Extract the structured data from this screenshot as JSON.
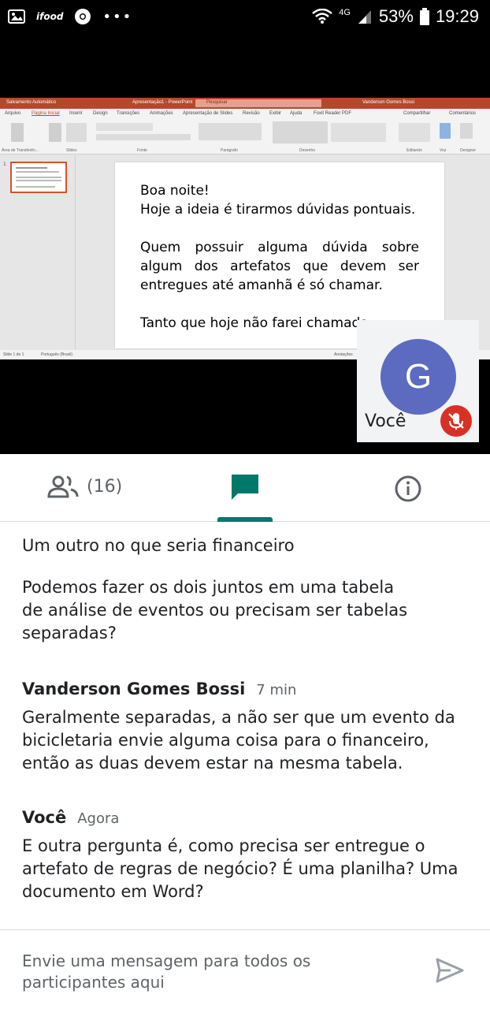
{
  "status_bar": {
    "network": "4G",
    "battery": "53%",
    "time": "19:29"
  },
  "presentation": {
    "slide_lines": {
      "l1": "Boa noite!",
      "l2": "Hoje a ideia é tirarmos dúvidas pontuais.",
      "p2": "Quem possuir alguma dúvida sobre algum dos artefatos que devem ser entregues até amanhã é só chamar.",
      "p3": "Tanto que hoje não farei chamada"
    },
    "window_title": "Apresentação1 - PowerPoint",
    "search_placeholder": "Pesquisar",
    "user": "Vanderson Gomes Bossi",
    "tabs": [
      "Arquivo",
      "Página Inicial",
      "Inserir",
      "Design",
      "Transições",
      "Animações",
      "Apresentação de Slides",
      "Revisão",
      "Exibir",
      "Ajuda",
      "Foxit Reader PDF"
    ],
    "share": "Compartilhar",
    "comments": "Comentários",
    "status_slide": "Slide 1 de 1",
    "status_lang": "Português (Brasil)",
    "status_notes": "Anotações"
  },
  "self_tile": {
    "avatar_letter": "G",
    "label": "Você"
  },
  "tabs": {
    "people_count": "(16)"
  },
  "chat": {
    "messages": [
      {
        "text": "Um outro no que seria financeiro"
      },
      {
        "text": "Podemos fazer os dois juntos em uma tabela de análise de eventos ou precisam ser tabelas separadas?"
      },
      {
        "sender": "Vanderson Gomes Bossi",
        "time": "7 min",
        "text": "Geralmente separadas, a não ser que um evento da bicicletaria envie alguma coisa para o financeiro, então as duas devem estar na mesma tabela."
      },
      {
        "sender": "Você",
        "time": "Agora",
        "text": "E outra pergunta é, como precisa ser entregue o artefato de regras de negócio? É uma planilha? Uma documento em Word?"
      }
    ]
  },
  "composer": {
    "placeholder": "Envie uma mensagem para todos os participantes aqui"
  },
  "colors": {
    "accent": "#00796b",
    "avatar": "#5c6bc0",
    "mic_off": "#d93025",
    "ppt_brand": "#b7472a"
  }
}
